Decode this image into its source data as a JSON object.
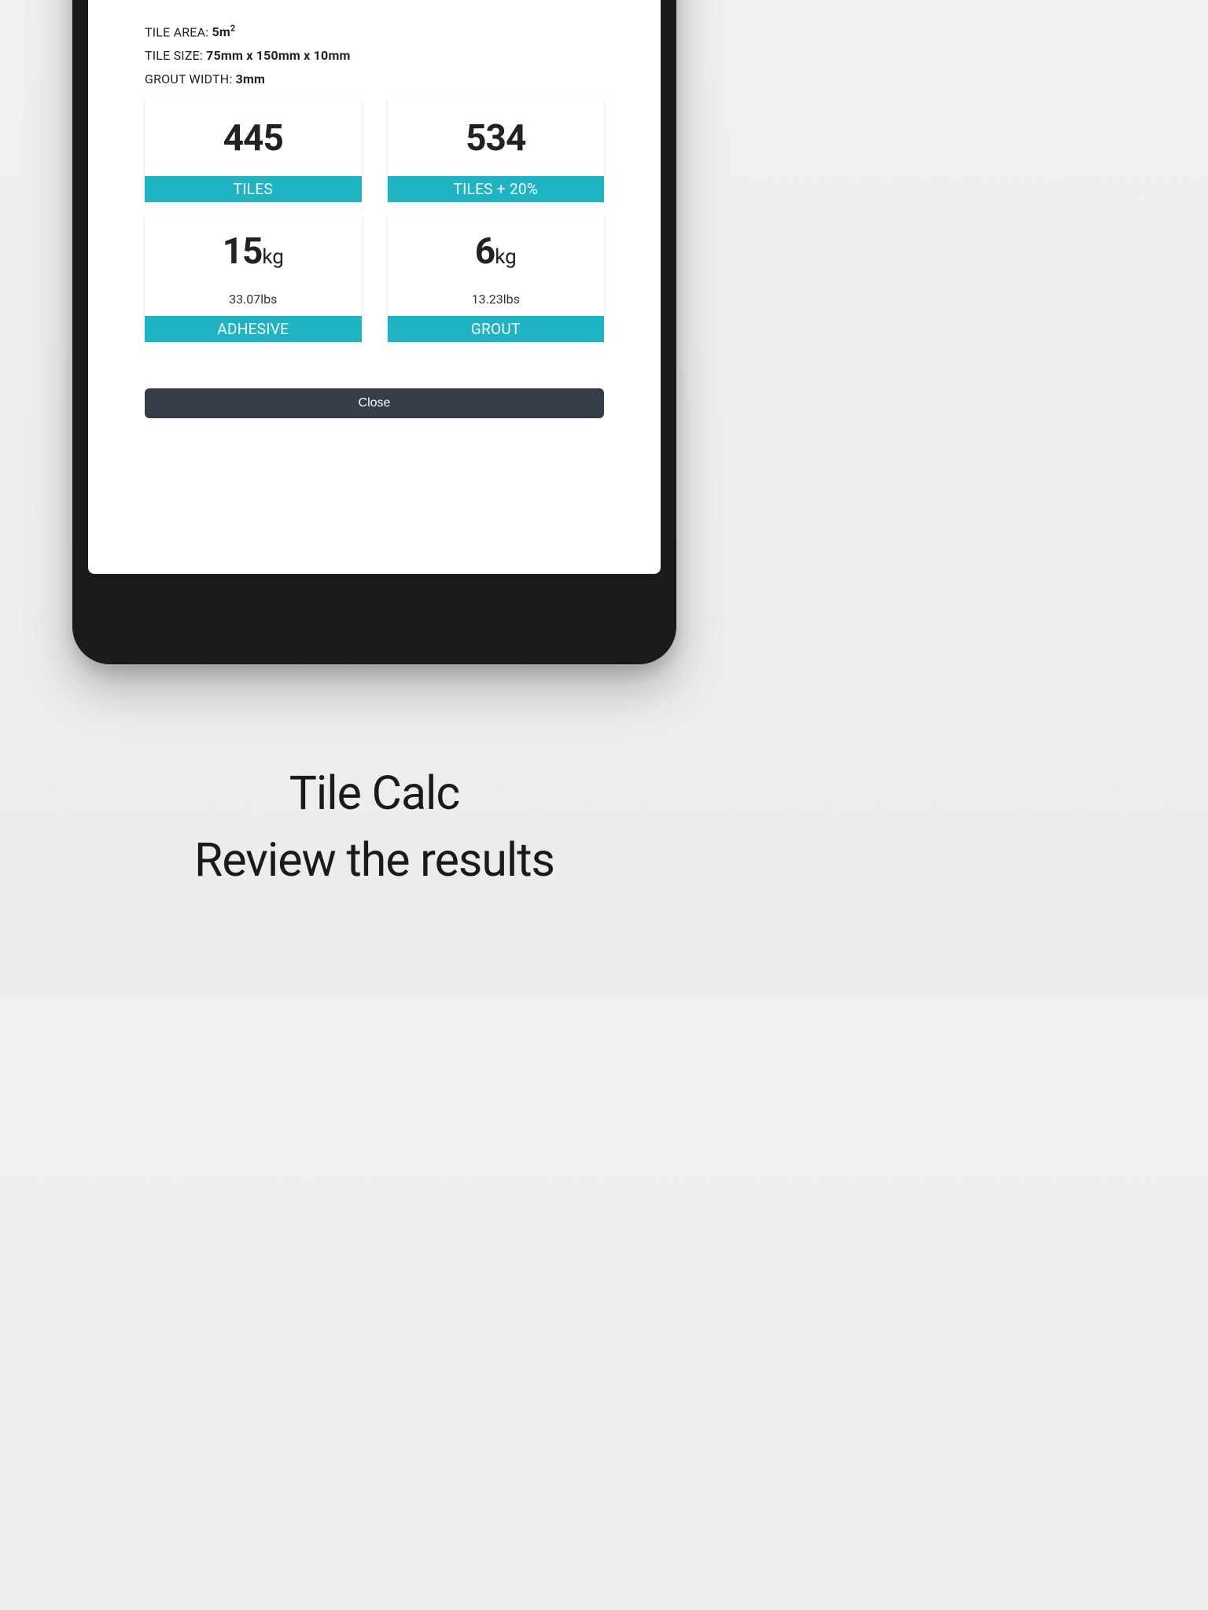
{
  "inputs": {
    "tile_area_label": "TILE AREA: ",
    "tile_area_value": "5m",
    "tile_area_sup": "2",
    "tile_size_label": "TILE SIZE: ",
    "tile_size_value": "75mm x 150mm x 10mm",
    "grout_width_label": "GROUT WIDTH: ",
    "grout_width_value": "3mm"
  },
  "results": {
    "tiles": {
      "value": "445",
      "label": "TILES"
    },
    "tiles_plus": {
      "value": "534",
      "label": "TILES + 20%"
    },
    "adhesive": {
      "value": "15",
      "unit": "kg",
      "sub": "33.07lbs",
      "label": "ADHESIVE"
    },
    "grout": {
      "value": "6",
      "unit": "kg",
      "sub": "13.23lbs",
      "label": "GROUT"
    }
  },
  "close_label": "Close",
  "caption_title": "Tile Calc",
  "caption_sub": "Review the results"
}
